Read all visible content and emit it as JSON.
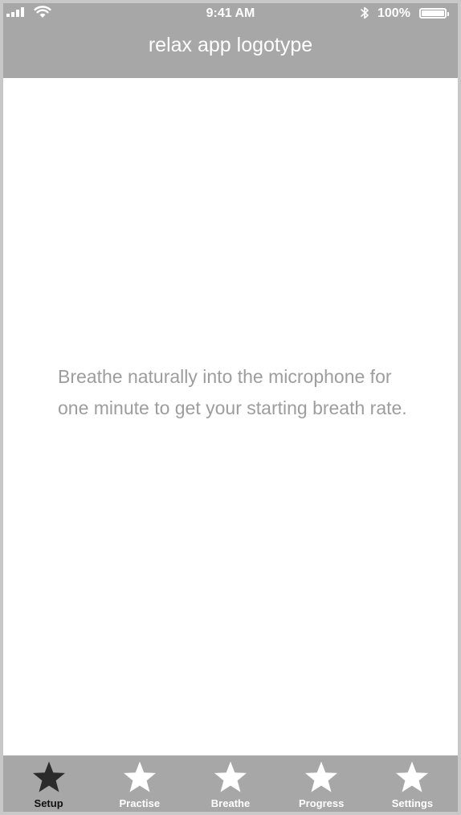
{
  "status_bar": {
    "time": "9:41 AM",
    "battery_percent": "100%",
    "icons": [
      "signal-icon",
      "wifi-icon",
      "bluetooth-icon",
      "battery-icon"
    ]
  },
  "header": {
    "logotype": "relax app logotype"
  },
  "main": {
    "instruction": "Breathe naturally into the microphone for one minute to get your starting breath rate."
  },
  "tab_bar": {
    "active_index": 0,
    "tabs": [
      {
        "label": "Setup",
        "icon": "star-icon"
      },
      {
        "label": "Practise",
        "icon": "star-icon"
      },
      {
        "label": "Breathe",
        "icon": "star-icon"
      },
      {
        "label": "Progress",
        "icon": "star-icon"
      },
      {
        "label": "Settings",
        "icon": "star-icon"
      }
    ]
  },
  "colors": {
    "bar_background": "#a7a7a7",
    "frame": "#c8c8c8",
    "body_text": "#9d9d9d",
    "active_tab": "#111111",
    "inactive_tab": "#ffffff"
  }
}
